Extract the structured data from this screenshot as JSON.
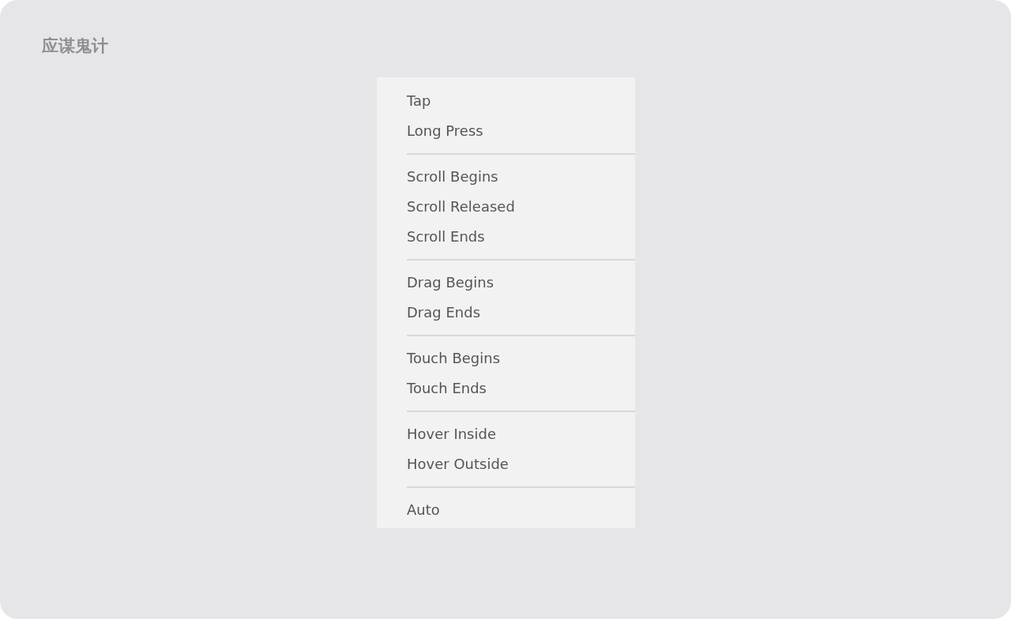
{
  "title": "应谋鬼计",
  "menu": {
    "groups": [
      {
        "items": [
          {
            "label": "Tap"
          },
          {
            "label": "Long Press"
          }
        ]
      },
      {
        "items": [
          {
            "label": "Scroll Begins"
          },
          {
            "label": "Scroll Released"
          },
          {
            "label": "Scroll Ends"
          }
        ]
      },
      {
        "items": [
          {
            "label": "Drag Begins"
          },
          {
            "label": "Drag Ends"
          }
        ]
      },
      {
        "items": [
          {
            "label": "Touch Begins"
          },
          {
            "label": "Touch Ends"
          }
        ]
      },
      {
        "items": [
          {
            "label": "Hover Inside"
          },
          {
            "label": "Hover Outside"
          }
        ]
      },
      {
        "items": [
          {
            "label": "Auto"
          }
        ]
      }
    ]
  }
}
